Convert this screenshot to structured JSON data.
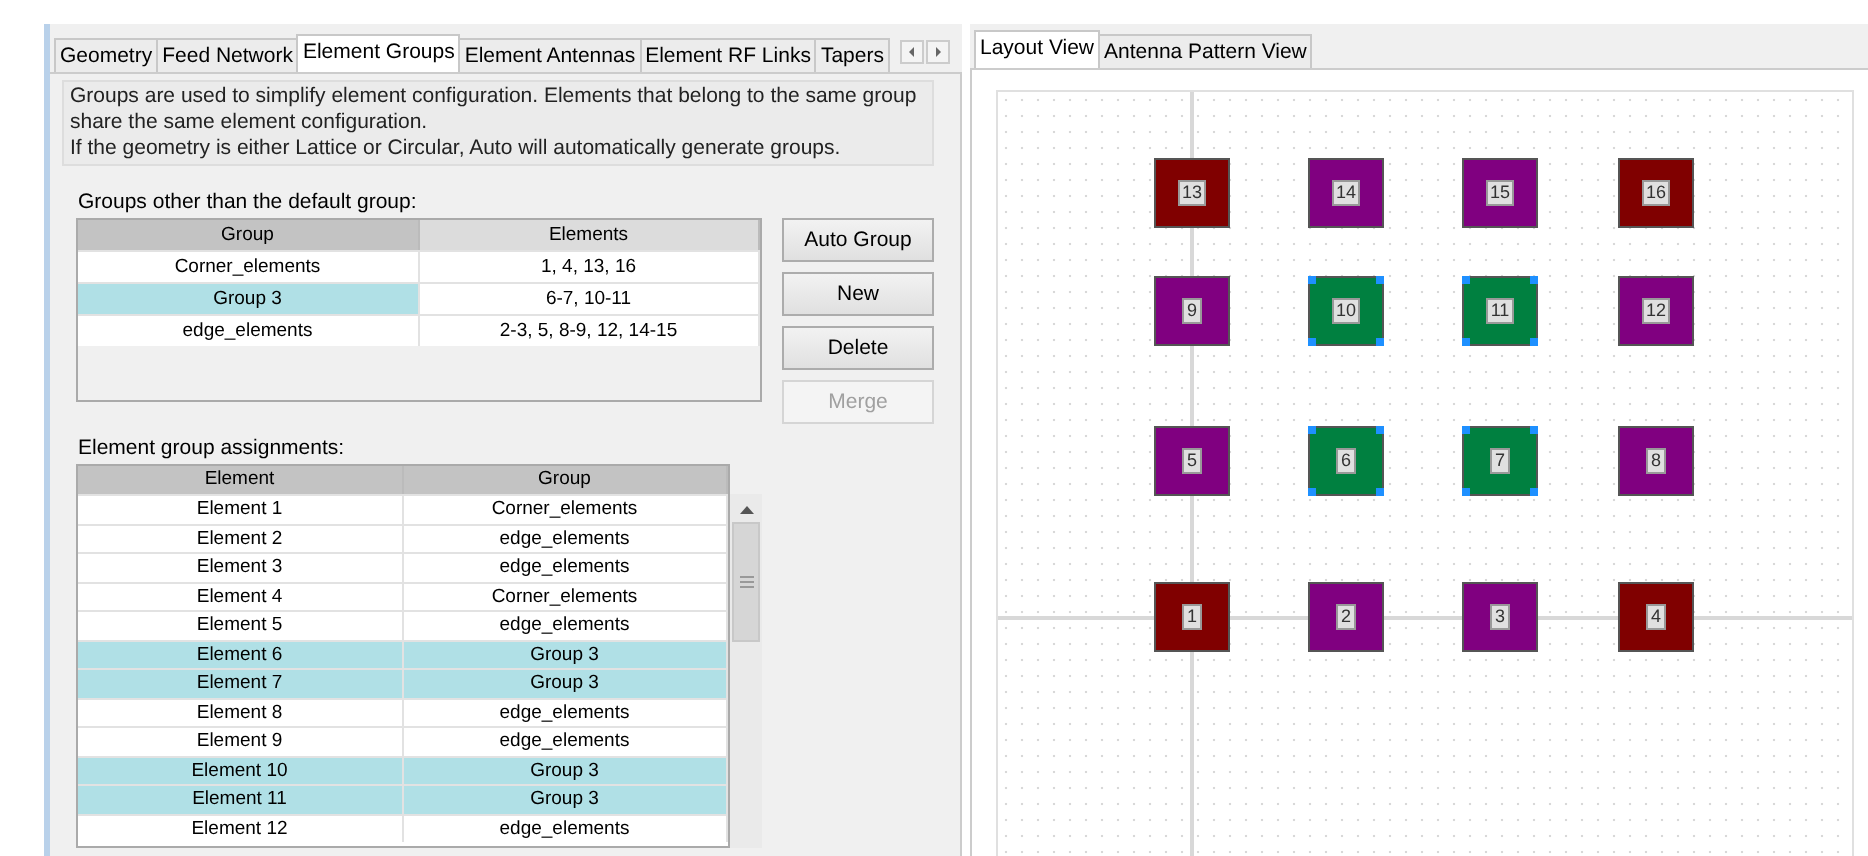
{
  "left_tabs": [
    {
      "label": "Geometry",
      "selected": false
    },
    {
      "label": "Feed Network",
      "selected": false
    },
    {
      "label": "Element Groups",
      "selected": true
    },
    {
      "label": "Element Antennas",
      "selected": false
    },
    {
      "label": "Element RF Links",
      "selected": false
    },
    {
      "label": "Tapers",
      "selected": false
    }
  ],
  "description": [
    "Groups are used to simplify element configuration. Elements that belong to the same group share the same element configuration.",
    "If the geometry is either Lattice or Circular, Auto will automatically generate groups."
  ],
  "groups_label": "Groups other than the default group:",
  "groups_table": {
    "columns": [
      "Group",
      "Elements"
    ],
    "rows": [
      {
        "group": "Corner_elements",
        "elements": "1, 4, 13, 16",
        "selected": false
      },
      {
        "group": "Group 3",
        "elements": "6-7, 10-11",
        "selected": true
      },
      {
        "group": "edge_elements",
        "elements": "2-3, 5, 8-9, 12, 14-15",
        "selected": false
      }
    ]
  },
  "buttons": [
    {
      "label": "Auto Group",
      "disabled": false
    },
    {
      "label": "New",
      "disabled": false
    },
    {
      "label": "Delete",
      "disabled": false
    },
    {
      "label": "Merge",
      "disabled": true
    }
  ],
  "assignments_label": "Element group assignments:",
  "assignments_table": {
    "columns": [
      "Element",
      "Group"
    ],
    "rows": [
      {
        "element": "Element 1",
        "group": "Corner_elements",
        "selected": false
      },
      {
        "element": "Element 2",
        "group": "edge_elements",
        "selected": false
      },
      {
        "element": "Element 3",
        "group": "edge_elements",
        "selected": false
      },
      {
        "element": "Element 4",
        "group": "Corner_elements",
        "selected": false
      },
      {
        "element": "Element 5",
        "group": "edge_elements",
        "selected": false
      },
      {
        "element": "Element 6",
        "group": "Group 3",
        "selected": true
      },
      {
        "element": "Element 7",
        "group": "Group 3",
        "selected": true
      },
      {
        "element": "Element 8",
        "group": "edge_elements",
        "selected": false
      },
      {
        "element": "Element 9",
        "group": "edge_elements",
        "selected": false
      },
      {
        "element": "Element 10",
        "group": "Group 3",
        "selected": true
      },
      {
        "element": "Element 11",
        "group": "Group 3",
        "selected": true
      },
      {
        "element": "Element 12",
        "group": "edge_elements",
        "selected": false
      }
    ]
  },
  "right_tabs": [
    {
      "label": "Layout View",
      "selected": true
    },
    {
      "label": "Antenna Pattern View",
      "selected": false
    }
  ],
  "layout_elements": [
    {
      "label": "13",
      "color": "#800000",
      "selected": false
    },
    {
      "label": "14",
      "color": "#800080",
      "selected": false
    },
    {
      "label": "15",
      "color": "#800080",
      "selected": false
    },
    {
      "label": "16",
      "color": "#800000",
      "selected": false
    },
    {
      "label": "9",
      "color": "#800080",
      "selected": false
    },
    {
      "label": "10",
      "color": "#008040",
      "selected": true
    },
    {
      "label": "11",
      "color": "#008040",
      "selected": true
    },
    {
      "label": "12",
      "color": "#800080",
      "selected": false
    },
    {
      "label": "5",
      "color": "#800080",
      "selected": false
    },
    {
      "label": "6",
      "color": "#008040",
      "selected": true
    },
    {
      "label": "7",
      "color": "#008040",
      "selected": true
    },
    {
      "label": "8",
      "color": "#800080",
      "selected": false
    },
    {
      "label": "1",
      "color": "#800000",
      "selected": false
    },
    {
      "label": "2",
      "color": "#800080",
      "selected": false
    },
    {
      "label": "3",
      "color": "#800080",
      "selected": false
    },
    {
      "label": "4",
      "color": "#800000",
      "selected": false
    }
  ]
}
